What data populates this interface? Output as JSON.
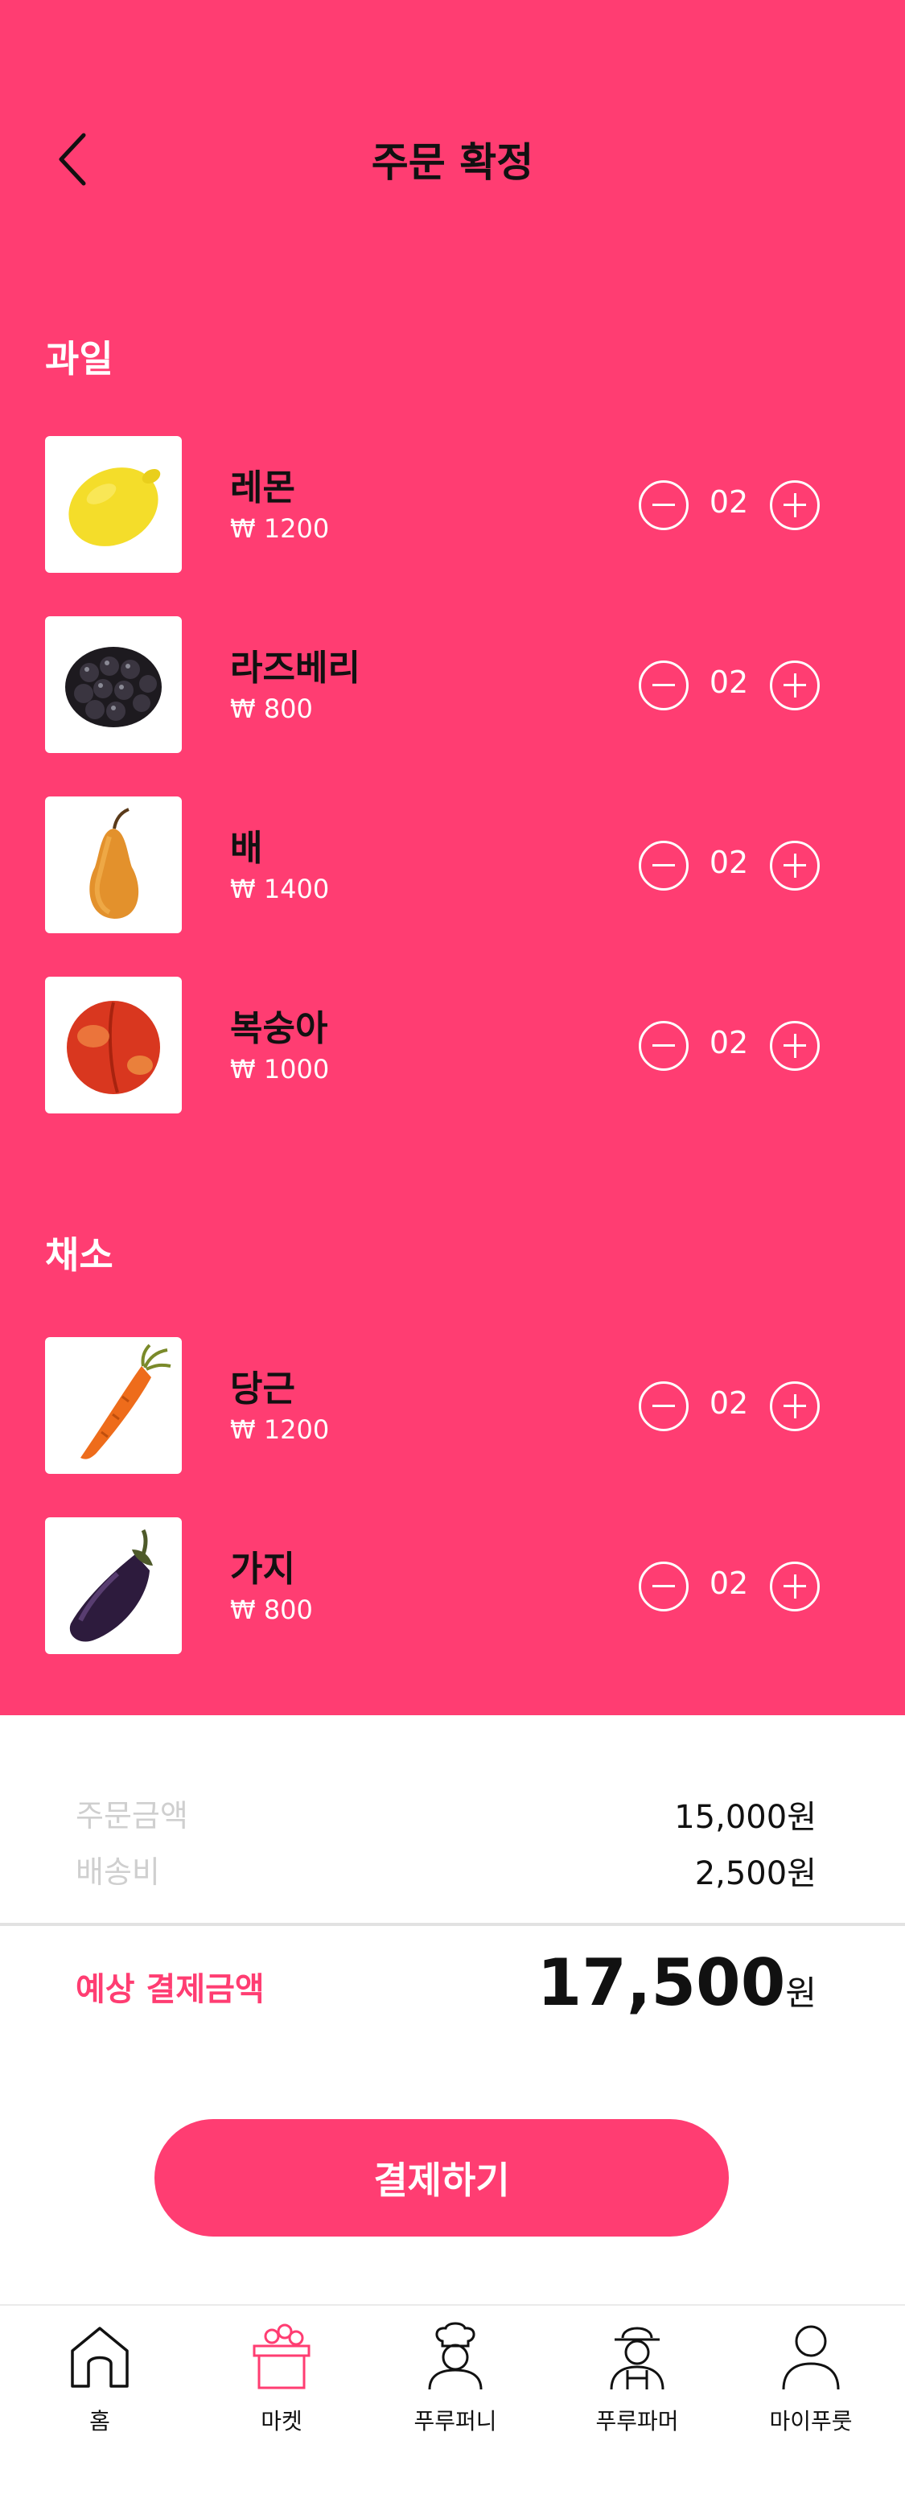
{
  "header": {
    "title": "주문 확정"
  },
  "sections": [
    {
      "title": "과일",
      "items": [
        {
          "name": "레몬",
          "price": "₩ 1200",
          "qty": "02",
          "image": "lemon-image"
        },
        {
          "name": "라즈베리",
          "price": "₩ 800",
          "qty": "02",
          "image": "blackberry-image"
        },
        {
          "name": "배",
          "price": "₩ 1400",
          "qty": "02",
          "image": "pear-image"
        },
        {
          "name": "복숭아",
          "price": "₩ 1000",
          "qty": "02",
          "image": "peach-image"
        }
      ]
    },
    {
      "title": "채소",
      "items": [
        {
          "name": "당근",
          "price": "₩ 1200",
          "qty": "02",
          "image": "carrot-image"
        },
        {
          "name": "가지",
          "price": "₩ 800",
          "qty": "02",
          "image": "eggplant-image"
        }
      ]
    }
  ],
  "summary": {
    "order_label": "주문금액",
    "order_value": "15,000원",
    "shipping_label": "배송비",
    "shipping_value": "2,500원",
    "expected_label": "예상 결제금액",
    "expected_value": "17,500",
    "expected_unit": "원"
  },
  "pay_button": "결제하기",
  "nav": [
    {
      "label": "홈",
      "icon": "home-icon"
    },
    {
      "label": "마켓",
      "icon": "market-icon"
    },
    {
      "label": "푸루퍼니",
      "icon": "chef-icon"
    },
    {
      "label": "푸루파머",
      "icon": "farmer-icon"
    },
    {
      "label": "마이푸룻",
      "icon": "user-icon"
    }
  ],
  "colors": {
    "accent": "#ff3d72",
    "muted": "#cfcfcf",
    "text": "#111111"
  }
}
